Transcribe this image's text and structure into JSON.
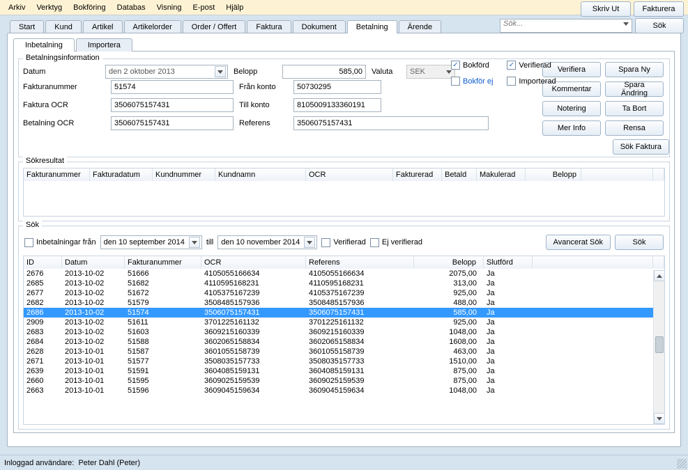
{
  "menu": [
    "Arkiv",
    "Verktyg",
    "Bokföring",
    "Databas",
    "Visning",
    "E-post",
    "Hjälp"
  ],
  "top_buttons": {
    "print": "Skriv Ut",
    "invoice": "Fakturera"
  },
  "global_search": {
    "placeholder": "Sök...",
    "button": "Sök"
  },
  "main_tabs": [
    "Start",
    "Kund",
    "Artikel",
    "Artikelorder",
    "Order / Offert",
    "Faktura",
    "Dokument",
    "Betalning",
    "Ärende"
  ],
  "active_main_tab": 7,
  "sub_tabs": [
    "Inbetalning",
    "Importera"
  ],
  "active_sub_tab": 0,
  "side_buttons": {
    "verifiera": "Verifiera",
    "spara_ny": "Spara Ny",
    "kommentar": "Kommentar",
    "spara_andring": "Spara Ändring",
    "notering": "Notering",
    "ta_bort": "Ta Bort",
    "mer_info": "Mer Info",
    "rensa": "Rensa"
  },
  "info": {
    "legend": "Betalningsinformation",
    "labels": {
      "datum": "Datum",
      "belopp": "Belopp",
      "valuta": "Valuta",
      "fakturanummer": "Fakturanummer",
      "fran_konto": "Från konto",
      "faktura_ocr": "Faktura OCR",
      "till_konto": "Till konto",
      "betalning_ocr": "Betalning OCR",
      "referens": "Referens"
    },
    "values": {
      "datum": "den  2  oktober  2013",
      "belopp": "585,00",
      "valuta": "SEK",
      "fakturanummer": "51574",
      "fran_konto": "50730295",
      "faktura_ocr": "3506075157431",
      "till_konto": "8105009133360191",
      "betalning_ocr": "3506075157431",
      "referens": "3506075157431"
    },
    "checks": {
      "bokford": {
        "label": "Bokförd",
        "checked": true
      },
      "verifierad": {
        "label": "Verifierad",
        "checked": true
      },
      "bokfor_ej": {
        "label": "Bokför ej",
        "checked": false,
        "blue": true
      },
      "importerad": {
        "label": "Importerad",
        "checked": false
      }
    },
    "sok_faktura": "Sök Faktura"
  },
  "sokresultat": {
    "legend": "Sökresultat",
    "headers": [
      "Fakturanummer",
      "Fakturadatum",
      "Kundnummer",
      "Kundnamn",
      "OCR",
      "Fakturerad",
      "Betald",
      "Makulerad",
      "Belopp",
      ""
    ]
  },
  "sok": {
    "legend": "Sök",
    "inbetalningar_fran": {
      "label": "Inbetalningar från",
      "checked": false
    },
    "date_from": "den 10 september 2014",
    "till": "till",
    "date_to": "den 10 november 2014",
    "verifierad": {
      "label": "Verifierad",
      "checked": false
    },
    "ej_verifierad": {
      "label": "Ej verifierad",
      "checked": false
    },
    "avancerat": "Avancerat Sök",
    "sok_btn": "Sök",
    "headers": [
      "ID",
      "Datum",
      "Fakturanummer",
      "OCR",
      "Referens",
      "Belopp",
      "Slutförd"
    ],
    "selected_id": "2686",
    "rows": [
      {
        "id": "2676",
        "datum": "2013-10-02",
        "fnr": "51666",
        "ocr": "4105055166634",
        "ref": "4105055166634",
        "belopp": "2075,00",
        "slut": "Ja"
      },
      {
        "id": "2685",
        "datum": "2013-10-02",
        "fnr": "51682",
        "ocr": "4110595168231",
        "ref": "4110595168231",
        "belopp": "313,00",
        "slut": "Ja"
      },
      {
        "id": "2677",
        "datum": "2013-10-02",
        "fnr": "51672",
        "ocr": "4105375167239",
        "ref": "4105375167239",
        "belopp": "925,00",
        "slut": "Ja"
      },
      {
        "id": "2682",
        "datum": "2013-10-02",
        "fnr": "51579",
        "ocr": "3508485157936",
        "ref": "3508485157936",
        "belopp": "488,00",
        "slut": "Ja"
      },
      {
        "id": "2686",
        "datum": "2013-10-02",
        "fnr": "51574",
        "ocr": "3506075157431",
        "ref": "3506075157431",
        "belopp": "585,00",
        "slut": "Ja"
      },
      {
        "id": "2909",
        "datum": "2013-10-02",
        "fnr": "51611",
        "ocr": "3701225161132",
        "ref": "3701225161132",
        "belopp": "925,00",
        "slut": "Ja"
      },
      {
        "id": "2683",
        "datum": "2013-10-02",
        "fnr": "51603",
        "ocr": "3609215160339",
        "ref": "3609215160339",
        "belopp": "1048,00",
        "slut": "Ja"
      },
      {
        "id": "2684",
        "datum": "2013-10-02",
        "fnr": "51588",
        "ocr": "3602065158834",
        "ref": "3602065158834",
        "belopp": "1608,00",
        "slut": "Ja"
      },
      {
        "id": "2628",
        "datum": "2013-10-01",
        "fnr": "51587",
        "ocr": "3601055158739",
        "ref": "3601055158739",
        "belopp": "463,00",
        "slut": "Ja"
      },
      {
        "id": "2671",
        "datum": "2013-10-01",
        "fnr": "51577",
        "ocr": "3508035157733",
        "ref": "3508035157733",
        "belopp": "1510,00",
        "slut": "Ja"
      },
      {
        "id": "2639",
        "datum": "2013-10-01",
        "fnr": "51591",
        "ocr": "3604085159131",
        "ref": "3604085159131",
        "belopp": "875,00",
        "slut": "Ja"
      },
      {
        "id": "2660",
        "datum": "2013-10-01",
        "fnr": "51595",
        "ocr": "3609025159539",
        "ref": "3609025159539",
        "belopp": "875,00",
        "slut": "Ja"
      },
      {
        "id": "2663",
        "datum": "2013-10-01",
        "fnr": "51596",
        "ocr": "3609045159634",
        "ref": "3609045159634",
        "belopp": "1048,00",
        "slut": "Ja"
      }
    ]
  },
  "status": {
    "label": "Inloggad användare:",
    "user": "Peter Dahl (Peter)"
  }
}
